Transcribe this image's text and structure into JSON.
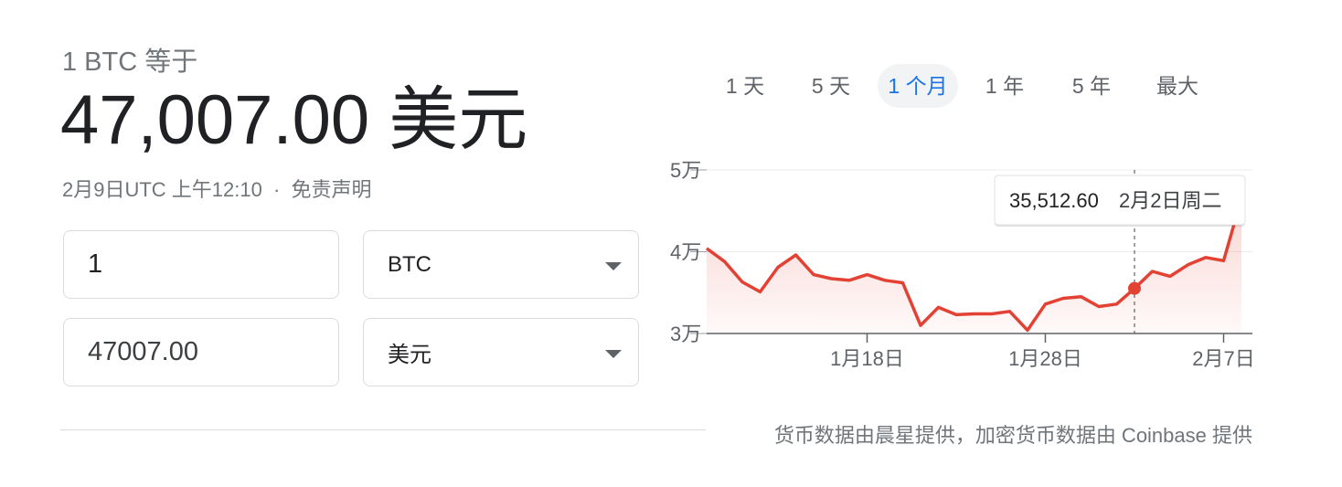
{
  "header": {
    "caption": "1 BTC 等于",
    "value": "47,007.00 美元",
    "timestamp": "2月9日UTC 上午12:10",
    "separator": "·",
    "disclaimer": "免责声明"
  },
  "converter": {
    "amount_from": "1",
    "currency_from": "BTC",
    "amount_to": "47007.00",
    "currency_to": "美元"
  },
  "tabs": [
    {
      "label": "1 天",
      "active": false
    },
    {
      "label": "5 天",
      "active": false
    },
    {
      "label": "1 个月",
      "active": true
    },
    {
      "label": "1 年",
      "active": false
    },
    {
      "label": "5 年",
      "active": false
    },
    {
      "label": "最大",
      "active": false
    }
  ],
  "source": "货币数据由晨星提供，加密货币数据由 Coinbase 提供",
  "colors": {
    "line": "#e34133",
    "accent": "#1a73e8"
  },
  "chart_data": {
    "type": "area",
    "x": [
      "1月9日",
      "1月10日",
      "1月11日",
      "1月12日",
      "1月13日",
      "1月14日",
      "1月15日",
      "1月16日",
      "1月17日",
      "1月18日",
      "1月19日",
      "1月20日",
      "1月21日",
      "1月22日",
      "1月23日",
      "1月24日",
      "1月25日",
      "1月26日",
      "1月27日",
      "1月28日",
      "1月29日",
      "1月30日",
      "1月31日",
      "2月1日",
      "2月2日",
      "2月3日",
      "2月4日",
      "2月5日",
      "2月6日",
      "2月7日",
      "2月8日"
    ],
    "series": [
      {
        "values": [
          40400,
          38800,
          36300,
          35100,
          38100,
          39600,
          37200,
          36700,
          36500,
          37200,
          36500,
          36200,
          31000,
          33200,
          32300,
          32400,
          32400,
          32700,
          30400,
          33600,
          34300,
          34500,
          33300,
          33600,
          35512.6,
          37600,
          37000,
          38400,
          39300,
          38900,
          46500
        ]
      }
    ],
    "ylim": [
      30000,
      50000
    ],
    "yticks": [
      {
        "value": 30000,
        "label": "3万"
      },
      {
        "value": 40000,
        "label": "4万"
      },
      {
        "value": 50000,
        "label": "5万"
      }
    ],
    "xticks": [
      {
        "index": 9,
        "label": "1月18日"
      },
      {
        "index": 19,
        "label": "1月28日"
      },
      {
        "index": 29,
        "label": "2月7日"
      }
    ],
    "tooltip": {
      "index": 24,
      "value": "35,512.60",
      "date": "2月2日周二"
    }
  }
}
